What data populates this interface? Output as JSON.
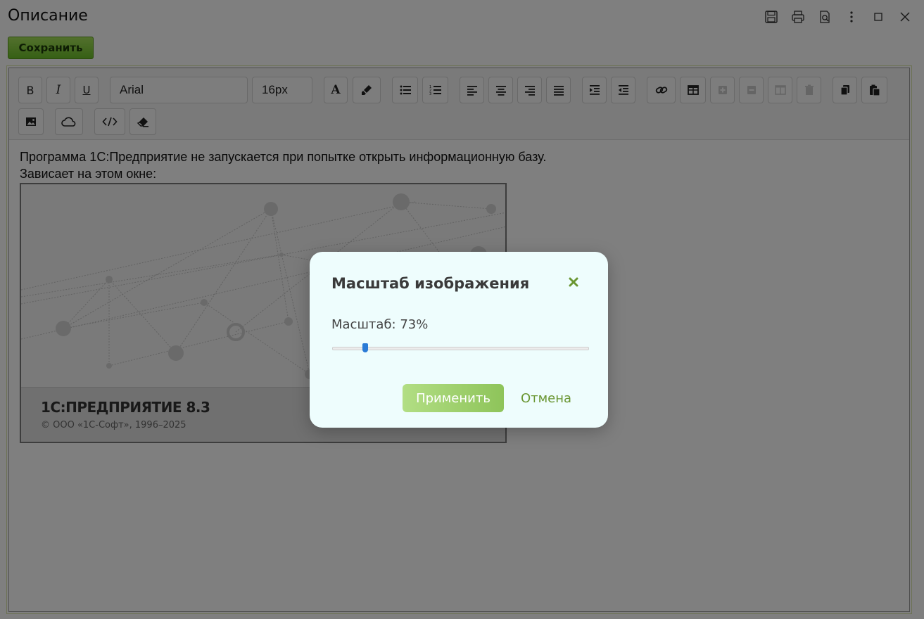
{
  "window": {
    "title": "Описание",
    "icons": [
      "save-icon",
      "print-icon",
      "preview-icon",
      "more-icon",
      "maximize-icon",
      "close-icon"
    ]
  },
  "toolbar_main": {
    "save_label": "Сохранить"
  },
  "editor": {
    "font_family_value": "Arial",
    "font_size_value": "16px",
    "content_lines": [
      "Программа 1С:Предприятие не запускается при попытке открыть информационную базу.",
      "Зависает на этом окне:"
    ],
    "image": {
      "product_name": "1С:ПРЕДПРИЯТИЕ 8.3",
      "copyright": "© ООО «1С-Софт», 1996–2025"
    }
  },
  "dialog": {
    "title": "Масштаб изображения",
    "label": "Масштаб: 73%",
    "scale_percent": 73,
    "slider_fraction": 0.13,
    "apply_label": "Применить",
    "cancel_label": "Отмена"
  },
  "colors": {
    "accent_green": "#6cc02a",
    "dialog_bg": "#eefdfd",
    "slider_thumb": "#2a7bd6",
    "cancel_text": "#6a9632"
  }
}
